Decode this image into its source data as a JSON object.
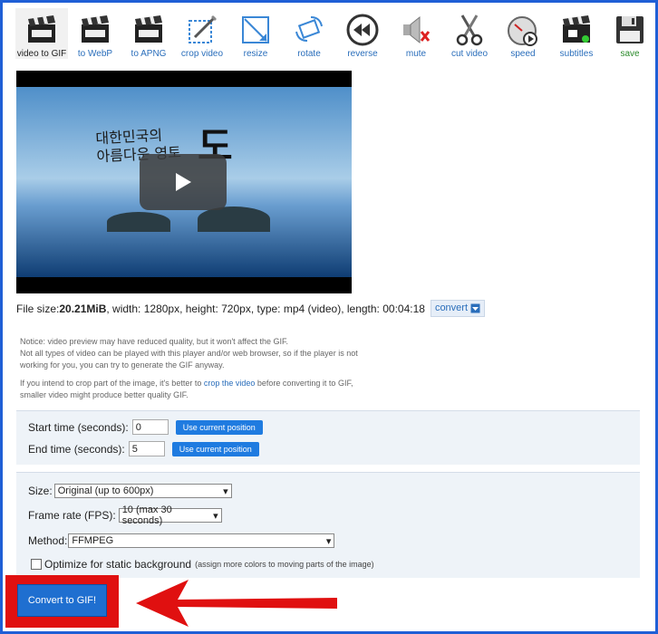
{
  "toolbar": {
    "items": [
      {
        "label": "video to GIF",
        "icon": "clapperboard-gif-icon"
      },
      {
        "label": "to WebP",
        "icon": "clapperboard-webp-icon"
      },
      {
        "label": "to APNG",
        "icon": "clapperboard-apng-icon"
      },
      {
        "label": "crop video",
        "icon": "crop-icon"
      },
      {
        "label": "resize",
        "icon": "resize-icon"
      },
      {
        "label": "rotate",
        "icon": "rotate-icon"
      },
      {
        "label": "reverse",
        "icon": "reverse-icon"
      },
      {
        "label": "mute",
        "icon": "mute-icon"
      },
      {
        "label": "cut video",
        "icon": "scissors-icon"
      },
      {
        "label": "speed",
        "icon": "speed-icon"
      },
      {
        "label": "subtitles",
        "icon": "subtitles-icon"
      },
      {
        "label": "save",
        "icon": "floppy-disk-icon"
      }
    ]
  },
  "video": {
    "overlay_line1": "대한민국의",
    "overlay_line2": "아름다운 영토",
    "overlay_big": "도"
  },
  "file_info": {
    "prefix": "File size: ",
    "size": "20.21MiB",
    "rest": ", width: 1280px, height: 720px, type: mp4 (video), length: 00:04:18",
    "convert_label": "convert"
  },
  "notice": {
    "line1": "Notice: video preview may have reduced quality, but it won't affect the GIF.",
    "line2": "Not all types of video can be played with this player and/or web browser, so if the player is not working for you, you can try to generate the GIF anyway.",
    "crop_pre": "If you intend to crop part of the image, it's better to ",
    "crop_link": "crop the video",
    "crop_post": " before converting it to GIF, smaller video might produce better quality GIF."
  },
  "times": {
    "start_label": "Start time (seconds):",
    "start_value": "0",
    "end_label": "End time (seconds):",
    "end_value": "5",
    "use_current": "Use current position"
  },
  "options": {
    "size_label": "Size:",
    "size_value": "Original (up to 600px)",
    "fps_label": "Frame rate (FPS):",
    "fps_value": "10 (max 30 seconds)",
    "method_label": "Method:",
    "method_value": "FFMPEG",
    "optimize_label": "Optimize for static background",
    "optimize_note": "(assign more colors to moving parts of the image)"
  },
  "cta": {
    "label": "Convert to GIF!"
  },
  "colors": {
    "accent": "#1f6fd0",
    "highlight": "#e01010",
    "link": "#2a6ebb"
  }
}
